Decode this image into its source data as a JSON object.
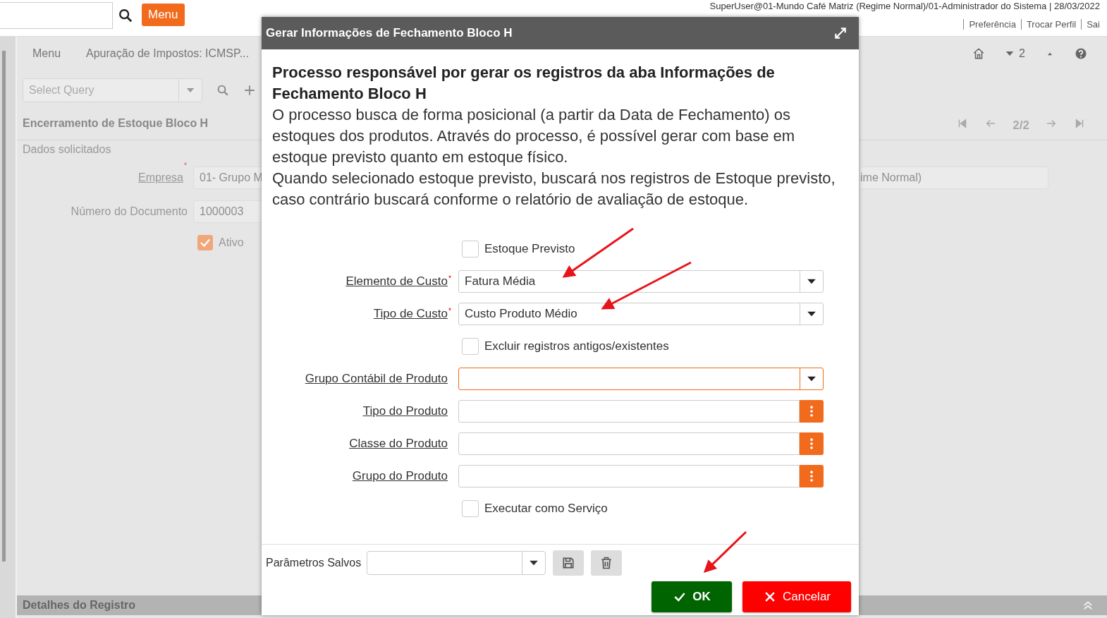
{
  "top_bar": {
    "menu_button": "Menu",
    "user_info": "SuperUser@01-Mundo Café Matriz (Regime Normal)/01-Administrador do Sistema | 28/03/2022",
    "links": [
      "Preferência",
      "Trocar Perfil",
      "Sai"
    ]
  },
  "header_links": [
    "Menu",
    "Apuração de Impostos: ICMSP..."
  ],
  "header_tools": {
    "count": "2"
  },
  "query": {
    "placeholder": "Select Query"
  },
  "record": {
    "title": "Encerramento de Estoque Bloco H",
    "position": "2/2",
    "section": "Dados solicitados",
    "fields": [
      {
        "label": "Empresa",
        "required": true,
        "value": "01- Grupo M",
        "value_end": "ime Normal)"
      },
      {
        "label": "Número do Documento",
        "required": false,
        "value": "1000003"
      }
    ],
    "active": {
      "label": "Ativo",
      "checked": true
    }
  },
  "details_bar": {
    "title": "Detalhes do Registro"
  },
  "dialog": {
    "title": "Gerar Informações de Fechamento Bloco H",
    "heading": "Processo responsável por gerar os registros da aba Informações de Fechamento Bloco H",
    "description": [
      "O processo busca de forma posicional (a partir da Data de Fechamento) os estoques dos produtos. Através do processo, é possível gerar com base em estoque previsto quanto em estoque físico.",
      "Quando selecionado estoque previsto, buscará nos registros de Estoque previsto, caso contrário buscará conforme o relatório de avaliação de estoque."
    ],
    "fields": [
      {
        "kind": "checkbox",
        "label": "Estoque Previsto",
        "checked": false
      },
      {
        "kind": "select",
        "label": "Elemento de Custo",
        "required": true,
        "focused": false,
        "value": "Fatura Média"
      },
      {
        "kind": "select",
        "label": "Tipo de Custo",
        "required": true,
        "focused": false,
        "value": "Custo Produto Médio"
      },
      {
        "kind": "checkbox",
        "label": "Excluir registros antigos/existentes",
        "checked": false
      },
      {
        "kind": "select",
        "label": "Grupo Contábil de Produto",
        "required": false,
        "focused": true
      },
      {
        "kind": "lookup",
        "label": "Tipo do Produto",
        "required": false
      },
      {
        "kind": "lookup",
        "label": "Classe do Produto",
        "required": false
      },
      {
        "kind": "lookup",
        "label": "Grupo do Produto",
        "required": false
      },
      {
        "kind": "checkbox",
        "label": "Executar como Serviço",
        "checked": false
      }
    ],
    "saved_params": {
      "label": "Parâmetros Salvos"
    },
    "buttons": [
      {
        "kind": "ok",
        "label": "OK"
      },
      {
        "kind": "cancel",
        "label": "Cancelar"
      }
    ]
  }
}
